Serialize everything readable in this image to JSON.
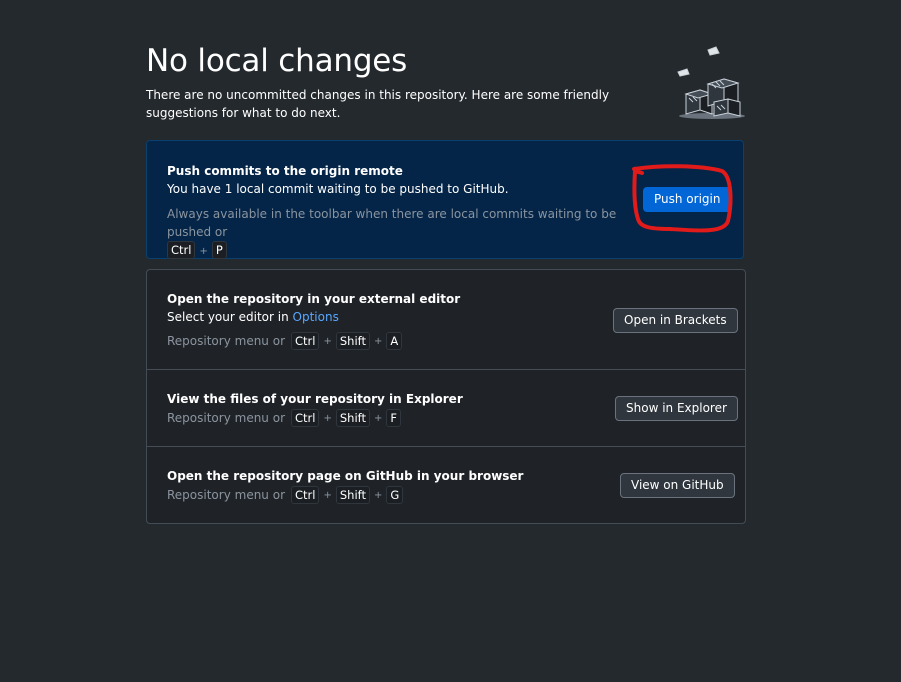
{
  "header": {
    "title": "No local changes",
    "subtitle": "There are no uncommitted changes in this repository. Here are some friendly suggestions for what to do next.",
    "illustration_icon": "boxes-illustration-icon"
  },
  "push_card": {
    "title": "Push commits to the origin remote",
    "description": "You have 1 local commit waiting to be pushed to GitHub.",
    "hint_text": "Always available in the toolbar when there are local commits waiting to be pushed or",
    "shortcut_keys": [
      "Ctrl",
      "P"
    ],
    "button_label": "Push origin",
    "button_color": "#0366d6"
  },
  "actions": [
    {
      "title": "Open the repository in your external editor",
      "description_prefix": "Select your editor in",
      "description_link": "Options",
      "hint_text": "Repository menu or",
      "shortcut_keys": [
        "Ctrl",
        "Shift",
        "A"
      ],
      "button_label": "Open in Brackets"
    },
    {
      "title": "View the files of your repository in Explorer",
      "hint_text": "Repository menu or",
      "shortcut_keys": [
        "Ctrl",
        "Shift",
        "F"
      ],
      "button_label": "Show in Explorer"
    },
    {
      "title": "Open the repository page on GitHub in your browser",
      "hint_text": "Repository menu or",
      "shortcut_keys": [
        "Ctrl",
        "Shift",
        "G"
      ],
      "button_label": "View on GitHub"
    }
  ],
  "colors": {
    "background": "#24292e",
    "accent": "#0366d6",
    "annotation": "#e11a1a",
    "link": "#58a6ff"
  }
}
